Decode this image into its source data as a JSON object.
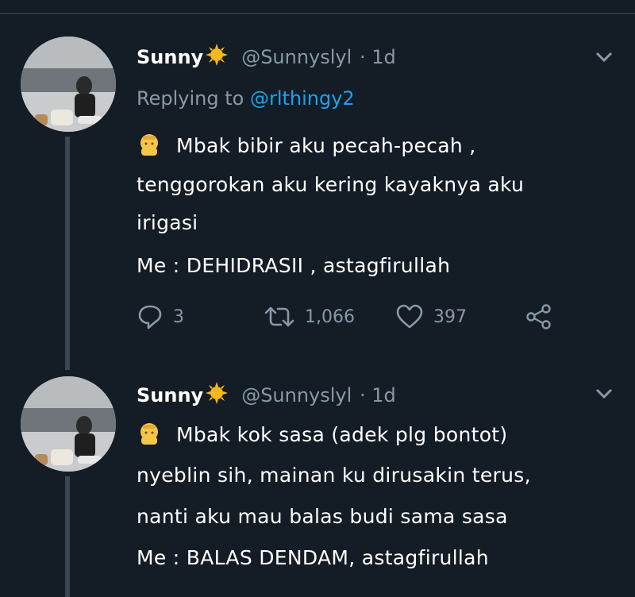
{
  "tweets": [
    {
      "name": "Sunny",
      "handle": "@Sunnyslyl",
      "time": "· 1d",
      "replying_prefix": "Replying to",
      "replying_to": "@rlthingy2",
      "lines": [
        "Mbak bibir aku pecah-pecah ,",
        "tenggorokan aku kering kayaknya aku",
        "irigasi",
        "Me : DEHIDRASII , astagfirullah"
      ],
      "replies": "3",
      "retweets": "1,066",
      "likes": "397"
    },
    {
      "name": "Sunny",
      "handle": "@Sunnyslyl",
      "time": "· 1d",
      "lines": [
        "Mbak kok sasa (adek plg bontot)",
        "nyeblin sih, mainan ku dirusakin terus,",
        "nanti aku mau balas budi sama sasa",
        "Me : BALAS DENDAM, astagfirullah"
      ]
    }
  ],
  "colors": {
    "background": "#141d26",
    "muted": "#8899a6",
    "link": "#1da1f2",
    "thread_line": "#3a4652"
  }
}
